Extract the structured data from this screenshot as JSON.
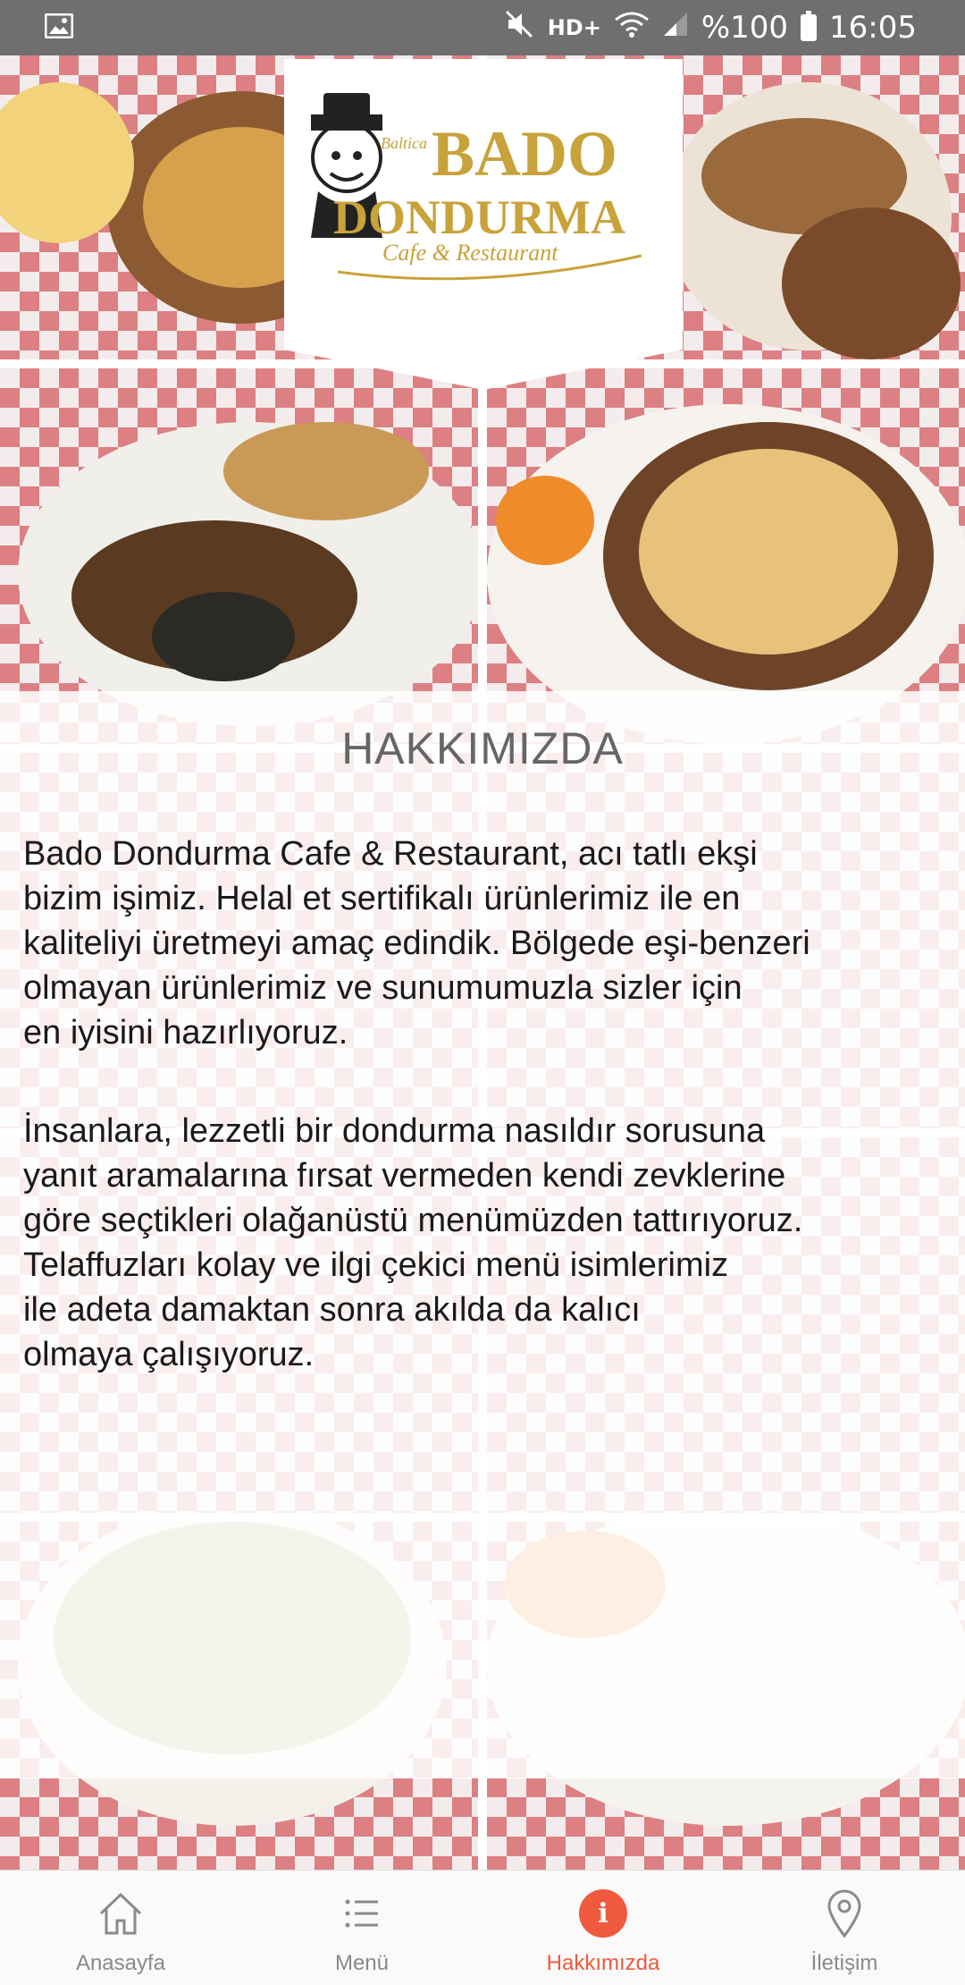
{
  "status_bar": {
    "signal_label": "HD+",
    "battery": "%100",
    "time": "16:05",
    "icons": [
      "image-icon",
      "mute-icon",
      "wifi-icon",
      "signal-icon",
      "battery-icon"
    ]
  },
  "logo": {
    "brand_small": "Baltica",
    "brand_main": "BADO",
    "brand_sub": "DONDURMA",
    "tagline": "Cafe & Restaurant"
  },
  "about": {
    "title": "HAKKIMIZDA",
    "paragraph_1": "Bado Dondurma Cafe & Restaurant,  acı tatlı ekşi\nbizim işimiz. Helal et sertifikalı ürünlerimiz ile en\nkaliteliyi üretmeyi amaç edindik. Bölgede eşi-benzeri\nolmayan ürünlerimiz ve sunumumuzla sizler için\nen iyisini hazırlıyoruz.",
    "paragraph_2": "İnsanlara, lezzetli bir dondurma nasıldır sorusuna\nyanıt aramalarına fırsat vermeden kendi zevklerine\ngöre seçtikleri olağanüstü menümüzden tattırıyoruz.\nTelaffuzları kolay ve ilgi çekici menü isimlerimiz\nile adeta damaktan sonra akılda da kalıcı\nolmaya çalışıyoruz."
  },
  "bottom_nav": {
    "items": [
      {
        "label": "Anasayfa",
        "icon": "home-icon",
        "active": false
      },
      {
        "label": "Menü",
        "icon": "list-icon",
        "active": false
      },
      {
        "label": "Hakkımızda",
        "icon": "info-icon",
        "active": true
      },
      {
        "label": "İletişim",
        "icon": "location-pin-icon",
        "active": false
      }
    ]
  },
  "colors": {
    "status_bar": "#6f6f6f",
    "accent": "#ef5a3e",
    "title": "#666666",
    "logo_gold": "#c8a23a"
  }
}
